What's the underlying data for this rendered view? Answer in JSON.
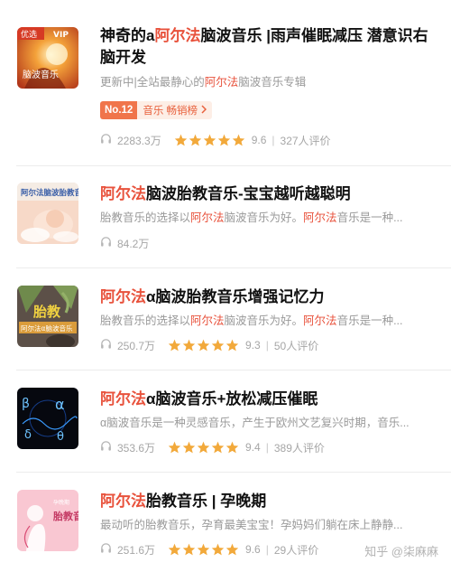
{
  "albums": [
    {
      "title_parts": [
        {
          "text": "神奇的a",
          "hl": false
        },
        {
          "text": "阿尔法",
          "hl": true
        },
        {
          "text": "脑波音乐 |雨声催眠减压 潜意识右脑开发",
          "hl": false
        }
      ],
      "desc_parts": [
        {
          "text": "更新中|全站最静心的",
          "hl": false
        },
        {
          "text": "阿尔法",
          "hl": true
        },
        {
          "text": "脑波音乐专辑",
          "hl": false
        }
      ],
      "cover_label": "优选",
      "cover_badge": "VIP",
      "cover_text": "脑波音乐",
      "rank": "No.12",
      "chart": "音乐 畅销榜",
      "plays": "2283.3万",
      "stars": 5,
      "score": "9.6",
      "reviews": "327人评价"
    },
    {
      "title_parts": [
        {
          "text": "阿尔法",
          "hl": true
        },
        {
          "text": "脑波胎教音乐-宝宝越听越聪明",
          "hl": false
        }
      ],
      "desc_parts": [
        {
          "text": "胎教音乐的选择以",
          "hl": false
        },
        {
          "text": "阿尔法",
          "hl": true
        },
        {
          "text": "脑波音乐为好。",
          "hl": false
        },
        {
          "text": "阿尔法",
          "hl": true
        },
        {
          "text": "音乐是一种...",
          "hl": false
        }
      ],
      "cover_text": "阿尔法脑波胎教音乐",
      "plays": "84.2万"
    },
    {
      "title_parts": [
        {
          "text": "阿尔法",
          "hl": true
        },
        {
          "text": "α脑波胎教音乐增强记忆力",
          "hl": false
        }
      ],
      "desc_parts": [
        {
          "text": "胎教音乐的选择以",
          "hl": false
        },
        {
          "text": "阿尔法",
          "hl": true
        },
        {
          "text": "脑波音乐为好。",
          "hl": false
        },
        {
          "text": "阿尔法",
          "hl": true
        },
        {
          "text": "音乐是一种...",
          "hl": false
        }
      ],
      "cover_text": "胎教",
      "cover_sub": "阿尔法α脑波音乐",
      "plays": "250.7万",
      "stars": 5,
      "score": "9.3",
      "reviews": "50人评价"
    },
    {
      "title_parts": [
        {
          "text": "阿尔法",
          "hl": true
        },
        {
          "text": "α脑波音乐+放松减压催眠",
          "hl": false
        }
      ],
      "desc_parts": [
        {
          "text": "α脑波音乐是一种灵感音乐，产生于欧州文艺复兴时期，音乐...",
          "hl": false
        }
      ],
      "cover_symbols": [
        "β",
        "α",
        "δ",
        "θ"
      ],
      "plays": "353.6万",
      "stars": 5,
      "score": "9.4",
      "reviews": "389人评价"
    },
    {
      "title_parts": [
        {
          "text": "阿尔法",
          "hl": true
        },
        {
          "text": "胎教音乐 | 孕晚期",
          "hl": false
        }
      ],
      "desc_parts": [
        {
          "text": "最动听的胎教音乐，孕育最美宝宝！孕妈妈们躺在床上静静...",
          "hl": false
        }
      ],
      "cover_text": "胎教音乐",
      "cover_tag": "孕晚期",
      "plays": "251.6万",
      "stars": 5,
      "score": "9.6",
      "reviews": "29人评价"
    }
  ],
  "watermark": "知乎 @柒麻麻",
  "colors": {
    "highlight": "#e8523c",
    "star": "#f2a93b",
    "muted": "#a6a6a6"
  },
  "icons": {
    "play_count": "headphone-icon",
    "rating": "star-icon",
    "badge_arrow": "chevron-right-icon"
  }
}
